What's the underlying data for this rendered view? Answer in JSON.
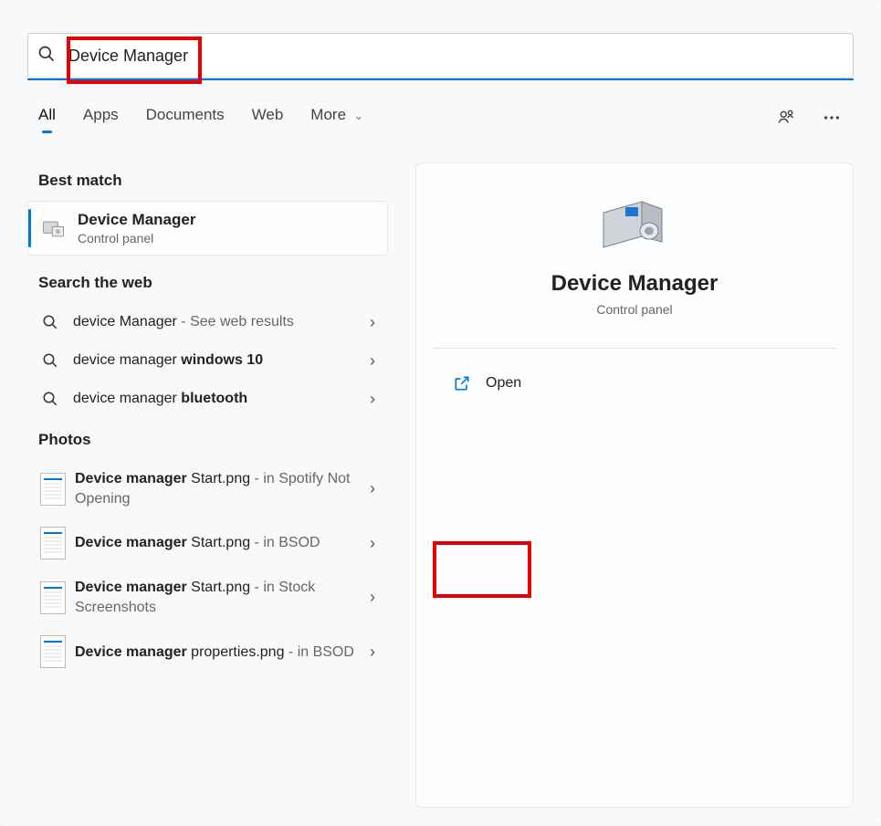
{
  "search": {
    "value": "Device Manager"
  },
  "tabs": {
    "items": [
      "All",
      "Apps",
      "Documents",
      "Web",
      "More"
    ],
    "active_index": 0
  },
  "sections": {
    "best_match": {
      "header": "Best match",
      "result": {
        "title": "Device Manager",
        "subtitle": "Control panel"
      }
    },
    "web": {
      "header": "Search the web",
      "items": [
        {
          "plain": "device Manager",
          "bold": "",
          "muted": " - See web results"
        },
        {
          "plain": "device manager ",
          "bold": "windows 10",
          "muted": ""
        },
        {
          "plain": "device manager ",
          "bold": "bluetooth",
          "muted": ""
        }
      ]
    },
    "photos": {
      "header": "Photos",
      "items": [
        {
          "bold": "Device manager",
          "rest": " Start.png",
          "muted": " - in Spotify Not Opening"
        },
        {
          "bold": "Device manager",
          "rest": " Start.png",
          "muted": " - in BSOD"
        },
        {
          "bold": "Device manager",
          "rest": " Start.png",
          "muted": " - in Stock Screenshots"
        },
        {
          "bold": "Device manager",
          "rest": " properties.png",
          "muted": " - in BSOD"
        }
      ]
    }
  },
  "preview": {
    "title": "Device Manager",
    "subtitle": "Control panel",
    "action": "Open"
  }
}
